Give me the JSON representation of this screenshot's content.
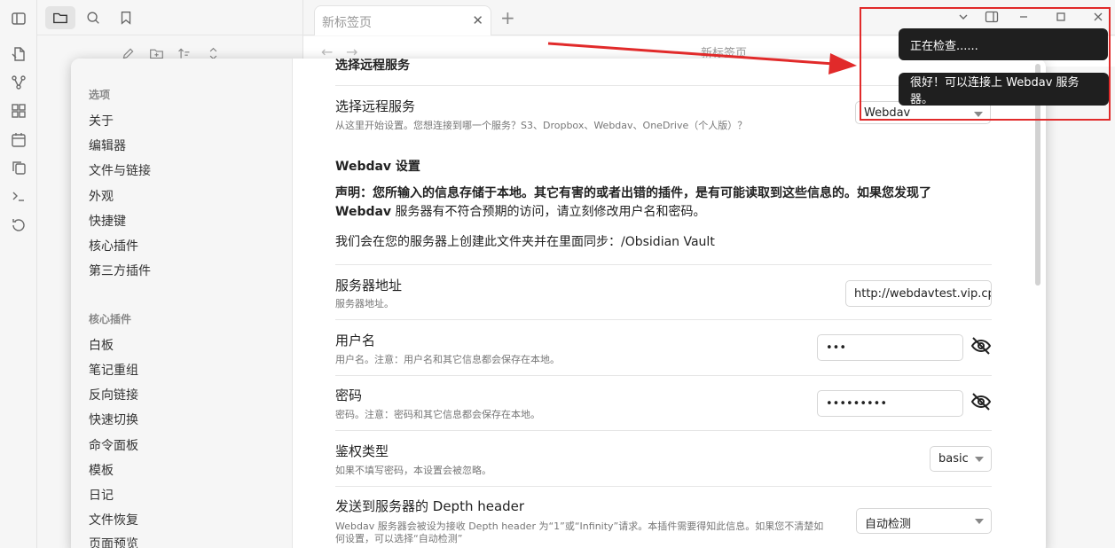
{
  "tab": {
    "title": "新标签页",
    "close": "✕",
    "new": "+"
  },
  "note_title": "新标签页",
  "settings": {
    "sidebar": {
      "options_title": "选项",
      "options": [
        "关于",
        "编辑器",
        "文件与链接",
        "外观",
        "快捷键",
        "核心插件",
        "第三方插件"
      ],
      "core_title": "核心插件",
      "core": [
        "白板",
        "笔记重组",
        "反向链接",
        "快速切换",
        "命令面板",
        "模板",
        "日记",
        "文件恢复",
        "页面预览"
      ]
    },
    "content": {
      "top_heading": "选择远程服务",
      "remote": {
        "name": "选择远程服务",
        "desc": "从这里开始设置。您想连接到哪一个服务？S3、Dropbox、Webdav、OneDrive（个人版）？",
        "value": "Webdav"
      },
      "webdav_heading": "Webdav 设置",
      "disclaimer": {
        "lead": "声明：您所输入的信息存储于本地。其它有害的或者出错的插件，是有可能读取到这些信息的。如果您发现了",
        "brand": "Webdav",
        "tail": " 服务器有不符合预期的访问，请立刻修改用户名和密码。"
      },
      "folder_note": "我们会在您的服务器上创建此文件夹并在里面同步：/Obsidian Vault",
      "server": {
        "name": "服务器地址",
        "desc": "服务器地址。",
        "value": "http://webdavtest.vip.cpo"
      },
      "username": {
        "name": "用户名",
        "desc": "用户名。注意：用户名和其它信息都会保存在本地。",
        "value": "•••"
      },
      "password": {
        "name": "密码",
        "desc": "密码。注意：密码和其它信息都会保存在本地。",
        "value": "•••••••••"
      },
      "auth": {
        "name": "鉴权类型",
        "desc": "如果不填写密码，本设置会被忽略。",
        "value": "basic"
      },
      "depth": {
        "name": "发送到服务器的 Depth header",
        "desc_line1": "Webdav 服务器会被设为接收 Depth header 为“1”或“Infinity”请求。本插件需要得知此信息。如果您不清楚如",
        "desc_line2": "何设置，可以选择“自动检测”",
        "value": "自动检测"
      }
    }
  },
  "notices": [
    "正在检查......",
    "很好！可以连接上 Webdav 服务器。"
  ],
  "colors": {
    "annotation": "#e12a2a",
    "notice_bg": "#1f1f1f"
  }
}
